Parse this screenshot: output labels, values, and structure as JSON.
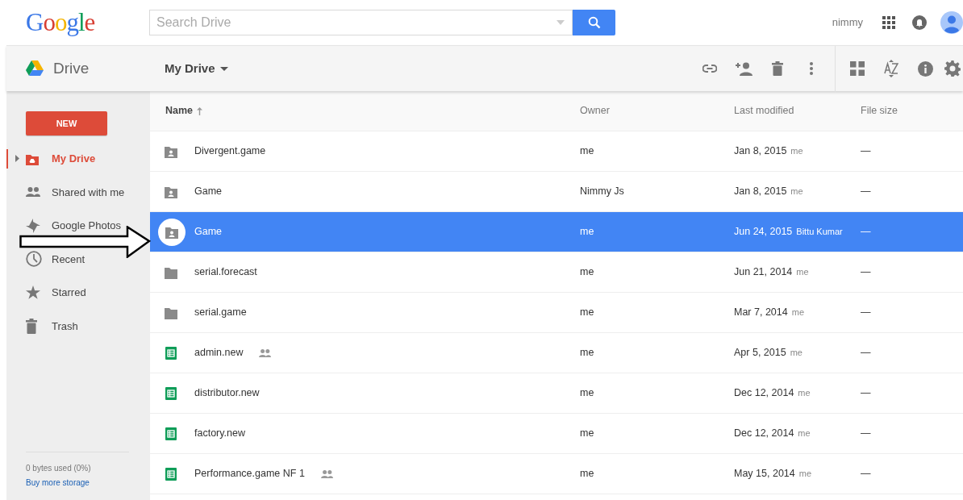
{
  "header": {
    "logo": "Google",
    "search": {
      "placeholder": "Search Drive"
    },
    "user": "nimmy"
  },
  "toolbar": {
    "app": "Drive",
    "location": "My Drive"
  },
  "sidebar": {
    "new_button": "NEW",
    "items": [
      {
        "label": "My Drive",
        "kind": "drive",
        "selected": true,
        "expandable": true
      },
      {
        "label": "Shared with me",
        "kind": "shared",
        "selected": false,
        "expandable": false
      },
      {
        "label": "Google Photos",
        "kind": "photos",
        "selected": false,
        "expandable": false
      },
      {
        "label": "Recent",
        "kind": "recent",
        "selected": false,
        "expandable": false
      },
      {
        "label": "Starred",
        "kind": "starred",
        "selected": false,
        "expandable": false
      },
      {
        "label": "Trash",
        "kind": "trash",
        "selected": false,
        "expandable": false
      }
    ],
    "storage": "0 bytes used (0%)",
    "buy_link": "Buy more storage"
  },
  "table": {
    "columns": [
      {
        "label": "Name",
        "sorted": true
      },
      {
        "label": "Owner",
        "sorted": false
      },
      {
        "label": "Last modified",
        "sorted": false
      },
      {
        "label": "File size",
        "sorted": false
      }
    ],
    "rows": [
      {
        "name": "Divergent.game",
        "kind": "shared-folder",
        "shared": false,
        "owner": "me",
        "modified": "Jan 8, 2015",
        "modified_by": "me",
        "size": "—",
        "selected": false
      },
      {
        "name": "Game",
        "kind": "shared-folder",
        "shared": false,
        "owner": "Nimmy Js",
        "modified": "Jan 8, 2015",
        "modified_by": "me",
        "size": "—",
        "selected": false
      },
      {
        "name": "Game",
        "kind": "shared-folder",
        "shared": false,
        "owner": "me",
        "modified": "Jun 24, 2015",
        "modified_by": "Bittu Kumar",
        "size": "—",
        "selected": true
      },
      {
        "name": "serial.forecast",
        "kind": "folder",
        "shared": false,
        "owner": "me",
        "modified": "Jun 21, 2014",
        "modified_by": "me",
        "size": "—",
        "selected": false
      },
      {
        "name": "serial.game",
        "kind": "folder",
        "shared": false,
        "owner": "me",
        "modified": "Mar 7, 2014",
        "modified_by": "me",
        "size": "—",
        "selected": false
      },
      {
        "name": "admin.new",
        "kind": "sheet",
        "shared": true,
        "owner": "me",
        "modified": "Apr 5, 2015",
        "modified_by": "me",
        "size": "—",
        "selected": false
      },
      {
        "name": "distributor.new",
        "kind": "sheet",
        "shared": false,
        "owner": "me",
        "modified": "Dec 12, 2014",
        "modified_by": "me",
        "size": "—",
        "selected": false
      },
      {
        "name": "factory.new",
        "kind": "sheet",
        "shared": false,
        "owner": "me",
        "modified": "Dec 12, 2014",
        "modified_by": "me",
        "size": "—",
        "selected": false
      },
      {
        "name": "Performance.game NF 1",
        "kind": "sheet",
        "shared": true,
        "owner": "me",
        "modified": "May 15, 2014",
        "modified_by": "me",
        "size": "—",
        "selected": false
      }
    ]
  }
}
